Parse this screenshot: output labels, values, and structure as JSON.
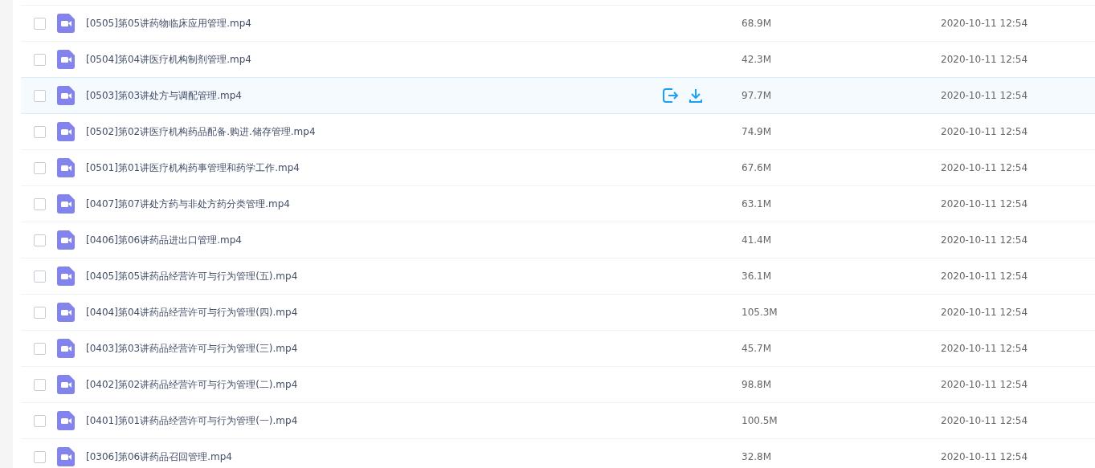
{
  "files": [
    {
      "name": "[0505]第05讲药物临床应用管理.mp4",
      "size": "68.9M",
      "modified": "2020-10-11 12:54",
      "checked": false,
      "highlighted": false
    },
    {
      "name": "[0504]第04讲医疗机构制剂管理.mp4",
      "size": "42.3M",
      "modified": "2020-10-11 12:54",
      "checked": false,
      "highlighted": false
    },
    {
      "name": "[0503]第03讲处方与调配管理.mp4",
      "size": "97.7M",
      "modified": "2020-10-11 12:54",
      "checked": false,
      "highlighted": true
    },
    {
      "name": "[0502]第02讲医疗机构药品配备.购进.储存管理.mp4",
      "size": "74.9M",
      "modified": "2020-10-11 12:54",
      "checked": false,
      "highlighted": false
    },
    {
      "name": "[0501]第01讲医疗机构药事管理和药学工作.mp4",
      "size": "67.6M",
      "modified": "2020-10-11 12:54",
      "checked": false,
      "highlighted": false
    },
    {
      "name": "[0407]第07讲处方药与非处方药分类管理.mp4",
      "size": "63.1M",
      "modified": "2020-10-11 12:54",
      "checked": false,
      "highlighted": false
    },
    {
      "name": "[0406]第06讲药品进出口管理.mp4",
      "size": "41.4M",
      "modified": "2020-10-11 12:54",
      "checked": false,
      "highlighted": false
    },
    {
      "name": "[0405]第05讲药品经营许可与行为管理(五).mp4",
      "size": "36.1M",
      "modified": "2020-10-11 12:54",
      "checked": false,
      "highlighted": false
    },
    {
      "name": "[0404]第04讲药品经营许可与行为管理(四).mp4",
      "size": "105.3M",
      "modified": "2020-10-11 12:54",
      "checked": false,
      "highlighted": false
    },
    {
      "name": "[0403]第03讲药品经营许可与行为管理(三).mp4",
      "size": "45.7M",
      "modified": "2020-10-11 12:54",
      "checked": false,
      "highlighted": false
    },
    {
      "name": "[0402]第02讲药品经营许可与行为管理(二).mp4",
      "size": "98.8M",
      "modified": "2020-10-11 12:54",
      "checked": false,
      "highlighted": false
    },
    {
      "name": "[0401]第01讲药品经营许可与行为管理(一).mp4",
      "size": "100.5M",
      "modified": "2020-10-11 12:54",
      "checked": false,
      "highlighted": false
    },
    {
      "name": "[0306]第06讲药品召回管理.mp4",
      "size": "32.8M",
      "modified": "2020-10-11 12:54",
      "checked": false,
      "highlighted": false
    }
  ]
}
